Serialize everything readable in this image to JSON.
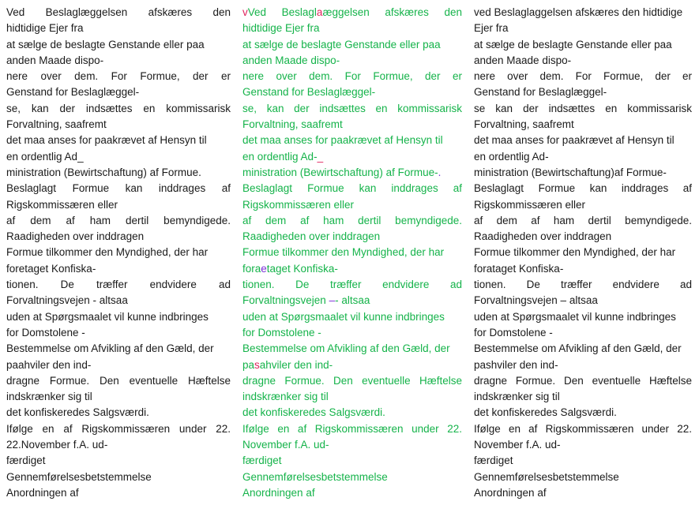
{
  "original": [
    {
      "t": "Ved Beslaglæggelsen afskæres den",
      "j": true
    },
    {
      "t": "hidtidige Ejer fra"
    },
    {
      "t": "at sælge de beslagte Genstande eller paa"
    },
    {
      "t": "anden Maade dispo-"
    },
    {
      "t": "nere over dem. For Formue, der er",
      "j": true
    },
    {
      "t": "Genstand for Beslaglæggel-"
    },
    {
      "t": "se, kan der indsættes en kommissarisk",
      "j": true
    },
    {
      "t": "Forvaltning, saafremt"
    },
    {
      "t": "det maa anses for paakrævet af Hensyn til"
    },
    {
      "t": "en ordentlig Ad_"
    },
    {
      "t": "ministration (Bewirtschaftung) af Formue."
    },
    {
      "t": "Beslaglagt Formue kan inddrages af",
      "j": true
    },
    {
      "t": "Rigskommissæren eller"
    },
    {
      "t": "af dem af ham dertil bemyndigede.",
      "j": true
    },
    {
      "t": "Raadigheden over inddragen"
    },
    {
      "t": "Formue tilkommer den Myndighed, der har"
    },
    {
      "t": "foretaget Konfiska-"
    },
    {
      "t": "tionen. De træffer endvidere ad",
      "j": true
    },
    {
      "t": "Forvaltningsvejen - altsaa"
    },
    {
      "t": "uden at Spørgsmaalet vil kunne indbringes"
    },
    {
      "t": "for Domstolene -"
    },
    {
      "t": "Bestemmelse om Afvikling af den Gæld, der"
    },
    {
      "t": "paahviler den ind-"
    },
    {
      "t": "dragne Formue. Den eventuelle Hæftelse",
      "j": true
    },
    {
      "t": "indskrænker sig til"
    },
    {
      "t": "det konfiskeredes Salgsværdi."
    },
    {
      "t": "Ifølge en af Rigskommissæren under 22.",
      "j": true
    },
    {
      "t": "22.November f.A. ud-"
    },
    {
      "t": "færdiget"
    },
    {
      "t": "Gennemførelsesbetstemmelse"
    },
    {
      "t": "Anordningen af"
    }
  ],
  "diff": [
    {
      "j": true,
      "segs": [
        {
          "t": "v",
          "c": "del"
        },
        {
          "t": "Ved Beslagl"
        },
        {
          "t": "a",
          "c": "del"
        },
        {
          "t": "æggelsen afskæres den"
        }
      ]
    },
    {
      "segs": [
        {
          "t": "hidtidige Ejer fra"
        }
      ]
    },
    {
      "segs": [
        {
          "t": "at sælge de beslagte Genstande eller paa"
        }
      ]
    },
    {
      "segs": [
        {
          "t": "anden Maade dispo-"
        }
      ]
    },
    {
      "j": true,
      "segs": [
        {
          "t": "nere over dem. For Formue, der er"
        }
      ]
    },
    {
      "segs": [
        {
          "t": "Genstand for Beslaglæggel-"
        }
      ]
    },
    {
      "j": true,
      "segs": [
        {
          "t": "se, kan der indsættes en kommissarisk"
        }
      ]
    },
    {
      "segs": [
        {
          "t": "Forvaltning, saafremt"
        }
      ]
    },
    {
      "segs": [
        {
          "t": "det maa anses for paakrævet af Hensyn til"
        }
      ]
    },
    {
      "segs": [
        {
          "t": "en ordentlig Ad-"
        },
        {
          "t": "_",
          "c": "del"
        }
      ]
    },
    {
      "segs": [
        {
          "t": "ministration (Bewirtschaftung) af Formue-"
        },
        {
          "t": ".",
          "c": "ins"
        }
      ]
    },
    {
      "j": true,
      "segs": [
        {
          "t": "Beslaglagt Formue kan inddrages af"
        }
      ]
    },
    {
      "segs": [
        {
          "t": "Rigskommissæren eller"
        }
      ]
    },
    {
      "j": true,
      "segs": [
        {
          "t": "af dem af ham dertil bemyndigede."
        }
      ]
    },
    {
      "segs": [
        {
          "t": "Raadigheden over inddragen"
        }
      ]
    },
    {
      "segs": [
        {
          "t": "Formue tilkommer den Myndighed, der har"
        }
      ]
    },
    {
      "segs": [
        {
          "t": "fora"
        },
        {
          "t": "e",
          "c": "ins"
        },
        {
          "t": "taget Konfiska-"
        }
      ]
    },
    {
      "j": true,
      "segs": [
        {
          "t": "tionen. De træffer endvidere ad"
        }
      ]
    },
    {
      "segs": [
        {
          "t": "Forvaltningsvejen "
        },
        {
          "t": "–",
          "c": "ins"
        },
        {
          "t": "- altsaa"
        }
      ]
    },
    {
      "segs": [
        {
          "t": "uden at Spørgsmaalet vil kunne indbringes"
        }
      ]
    },
    {
      "segs": [
        {
          "t": "for Domstolene -"
        }
      ]
    },
    {
      "segs": [
        {
          "t": "Bestemmelse om Afvikling af den Gæld, der"
        }
      ]
    },
    {
      "segs": [
        {
          "t": "pa"
        },
        {
          "t": "s",
          "c": "del"
        },
        {
          "t": "ahviler den ind-"
        }
      ]
    },
    {
      "j": true,
      "segs": [
        {
          "t": "dragne Formue. Den eventuelle Hæftelse"
        }
      ]
    },
    {
      "segs": [
        {
          "t": "indskrænker sig til"
        }
      ]
    },
    {
      "segs": [
        {
          "t": "det konfiskeredes Salgsværdi."
        }
      ]
    },
    {
      "j": true,
      "segs": [
        {
          "t": "Ifølge en af Rigskommissæren under 22."
        }
      ]
    },
    {
      "segs": [
        {
          "t": "November f.A. ud-"
        }
      ]
    },
    {
      "segs": [
        {
          "t": "færdiget"
        }
      ]
    },
    {
      "segs": [
        {
          "t": "Gennemførelsesbetstemmelse"
        }
      ]
    },
    {
      "segs": [
        {
          "t": "Anordningen af"
        }
      ]
    }
  ],
  "corrected": [
    {
      "t": "ved Beslaglaggelsen afskæres den hidtidige"
    },
    {
      "t": "Ejer fra"
    },
    {
      "t": "at sælge de beslagte Genstande eller paa"
    },
    {
      "t": "anden Maade dispo-"
    },
    {
      "t": "nere over dem. For Formue, der er",
      "j": true
    },
    {
      "t": "Genstand for Beslaglæggel-"
    },
    {
      "t": "se kan der indsættes en kommissarisk",
      "j": true
    },
    {
      "t": "Forvaltning, saafremt"
    },
    {
      "t": "det maa anses for paakrævet af Hensyn til"
    },
    {
      "t": "en ordentlig Ad-"
    },
    {
      "t": "ministration (Bewirtschaftung)af Formue-"
    },
    {
      "t": "Beslaglagt Formue kan inddrages af",
      "j": true
    },
    {
      "t": "Rigskommissæren eller"
    },
    {
      "t": "af dem af ham dertil bemyndigede.",
      "j": true
    },
    {
      "t": "Raadigheden over inddragen"
    },
    {
      "t": "Formue tilkommer den Myndighed, der har"
    },
    {
      "t": "forataget Konfiska-"
    },
    {
      "t": "tionen. De træffer endvidere ad",
      "j": true
    },
    {
      "t": "Forvaltningsvejen – altsaa"
    },
    {
      "t": "uden at Spørgsmaalet vil kunne indbringes"
    },
    {
      "t": "for Domstolene -"
    },
    {
      "t": "Bestemmelse om Afvikling af den Gæld, der"
    },
    {
      "t": "pashviler den ind-"
    },
    {
      "t": "dragne Formue. Den eventuelle Hæftelse",
      "j": true
    },
    {
      "t": "indskrænker sig til"
    },
    {
      "t": "det konfiskeredes Salgsværdi."
    },
    {
      "t": "Ifølge en af Rigskommissæren under 22.",
      "j": true
    },
    {
      "t": "November f.A. ud-"
    },
    {
      "t": "færdiget"
    },
    {
      "t": "Gennemførelsesbetstemmelse"
    },
    {
      "t": "Anordningen af"
    }
  ]
}
